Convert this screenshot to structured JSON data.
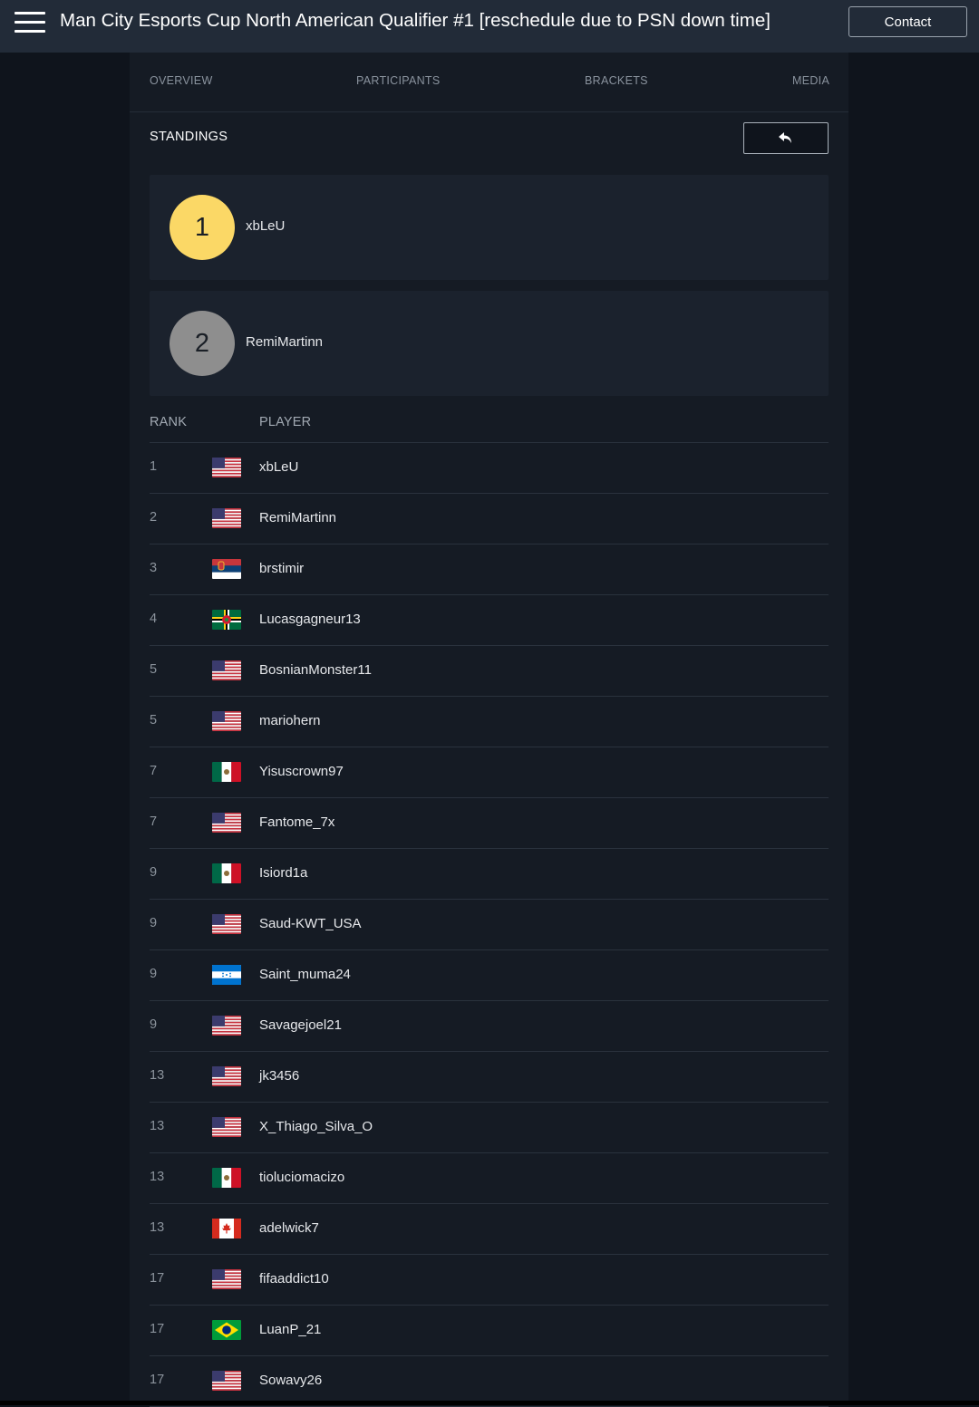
{
  "header": {
    "title": "Man City Esports Cup North American Qualifier #1 [reschedule due to PSN down time]",
    "contact_label": "Contact",
    "menu_icon": "hamburger-icon"
  },
  "tabs": [
    {
      "label": "OVERVIEW"
    },
    {
      "label": "PARTICIPANTS"
    },
    {
      "label": "BRACKETS"
    },
    {
      "label": "MEDIA"
    }
  ],
  "standings": {
    "title": "STANDINGS",
    "back_icon": "undo-arrow-icon",
    "podium": [
      {
        "place": "1",
        "name": "xbLeU",
        "color": "#fbd866"
      },
      {
        "place": "2",
        "name": "RemiMartinn",
        "color": "#8e8e8e"
      }
    ],
    "columns": {
      "rank": "RANK",
      "player": "PLAYER"
    },
    "rows": [
      {
        "rank": "1",
        "flag": "us",
        "name": "xbLeU"
      },
      {
        "rank": "2",
        "flag": "us",
        "name": "RemiMartinn"
      },
      {
        "rank": "3",
        "flag": "rs",
        "name": "brstimir"
      },
      {
        "rank": "4",
        "flag": "dm",
        "name": "Lucasgagneur13"
      },
      {
        "rank": "5",
        "flag": "us",
        "name": "BosnianMonster11"
      },
      {
        "rank": "5",
        "flag": "us",
        "name": "mariohern"
      },
      {
        "rank": "7",
        "flag": "mx",
        "name": "Yisuscrown97"
      },
      {
        "rank": "7",
        "flag": "us",
        "name": "Fantome_7x"
      },
      {
        "rank": "9",
        "flag": "mx",
        "name": "Isiord1a"
      },
      {
        "rank": "9",
        "flag": "us",
        "name": "Saud-KWT_USA"
      },
      {
        "rank": "9",
        "flag": "hn",
        "name": "Saint_muma24"
      },
      {
        "rank": "9",
        "flag": "us",
        "name": "Savagejoel21"
      },
      {
        "rank": "13",
        "flag": "us",
        "name": "jk3456"
      },
      {
        "rank": "13",
        "flag": "us",
        "name": "X_Thiago_Silva_O"
      },
      {
        "rank": "13",
        "flag": "mx",
        "name": "tioluciomacizo"
      },
      {
        "rank": "13",
        "flag": "ca",
        "name": "adelwick7"
      },
      {
        "rank": "17",
        "flag": "us",
        "name": "fifaaddict10"
      },
      {
        "rank": "17",
        "flag": "br",
        "name": "LuanP_21"
      },
      {
        "rank": "17",
        "flag": "us",
        "name": "Sowavy26"
      }
    ]
  }
}
